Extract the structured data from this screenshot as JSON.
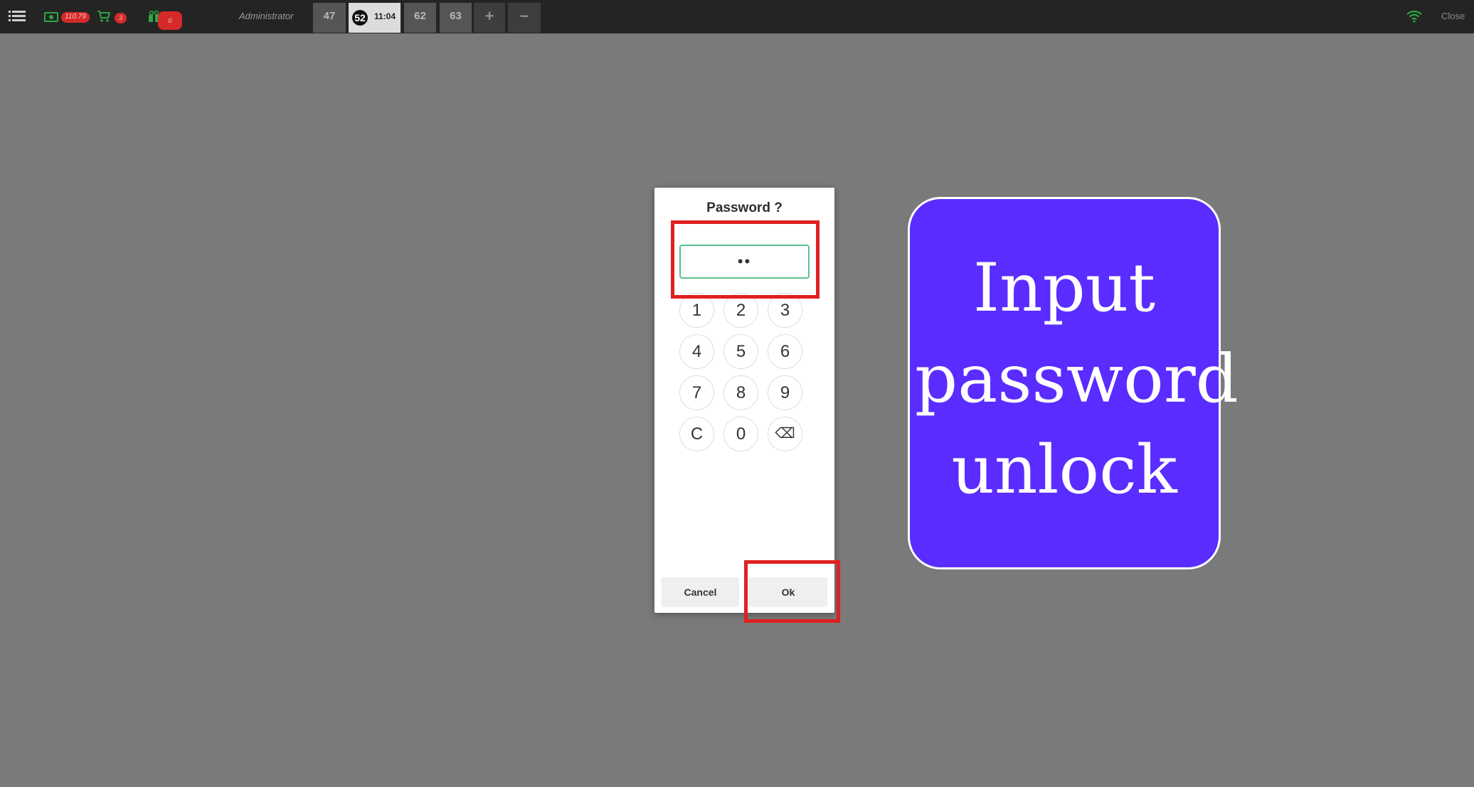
{
  "topbar": {
    "cash_amount": "110.79",
    "cart_count": "3",
    "gift_count": "0",
    "user": "Administrator",
    "tabs": [
      {
        "label": "47"
      },
      {
        "label": "52",
        "time": "11:04"
      },
      {
        "label": "62"
      },
      {
        "label": "63"
      },
      {
        "label": "+"
      },
      {
        "label": "−"
      }
    ],
    "close_label": "Close",
    "status_color": "#2aa744"
  },
  "dialog": {
    "title": "Password ?",
    "password_value": "••",
    "keys": [
      "1",
      "2",
      "3",
      "4",
      "5",
      "6",
      "7",
      "8",
      "9",
      "C",
      "0",
      "⌫"
    ],
    "cancel_label": "Cancel",
    "ok_label": "Ok"
  },
  "card": {
    "lines": [
      "Input",
      "password",
      "unlock"
    ],
    "color": "#5a2cff"
  },
  "highlight_color": "#e02020"
}
